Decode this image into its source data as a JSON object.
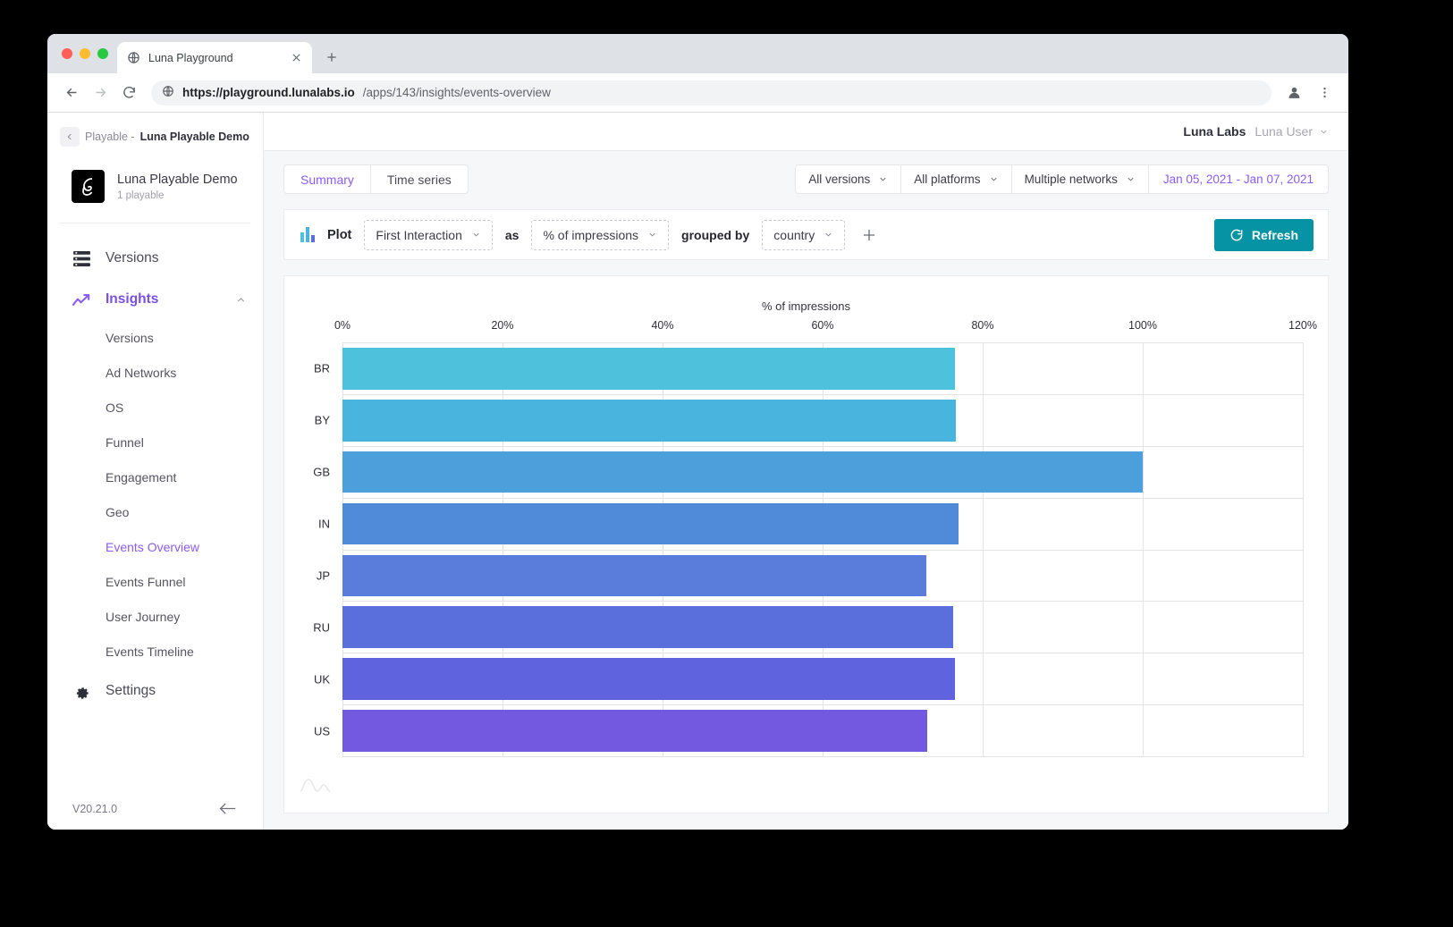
{
  "browser": {
    "tab_title": "Luna Playground",
    "tab_favicon": "globe-icon",
    "new_tab": "+",
    "close": "×",
    "url_host": "https://playground.lunalabs.io",
    "url_path": "/apps/143/insights/events-overview",
    "back_icon": "arrow-left-icon",
    "forward_icon": "arrow-right-icon",
    "reload_icon": "reload-icon",
    "profile_icon": "account-icon",
    "menu_icon": "kebab-menu-icon"
  },
  "sidebar": {
    "breadcrumb_prefix": "Playable - ",
    "breadcrumb_name": "Luna Playable Demo",
    "app_name": "Luna Playable Demo",
    "app_sub": "1 playable",
    "nav": [
      {
        "label": "Versions",
        "icon": "list-icon",
        "active": false
      },
      {
        "label": "Insights",
        "icon": "trending-up-icon",
        "active": true
      }
    ],
    "insights_children": [
      {
        "label": "Versions",
        "active": false
      },
      {
        "label": "Ad Networks",
        "active": false
      },
      {
        "label": "OS",
        "active": false
      },
      {
        "label": "Funnel",
        "active": false
      },
      {
        "label": "Engagement",
        "active": false
      },
      {
        "label": "Geo",
        "active": false
      },
      {
        "label": "Events Overview",
        "active": true
      },
      {
        "label": "Events Funnel",
        "active": false
      },
      {
        "label": "User Journey",
        "active": false
      },
      {
        "label": "Events Timeline",
        "active": false
      }
    ],
    "settings": {
      "label": "Settings",
      "icon": "gear-icon"
    },
    "version": "V20.21.0",
    "collapse_icon": "arrow-left-icon"
  },
  "topbar": {
    "org": "Luna Labs",
    "user": "Luna User",
    "caret": "chevron-down-icon"
  },
  "view_tabs": [
    {
      "label": "Summary",
      "active": true
    },
    {
      "label": "Time series",
      "active": false
    }
  ],
  "filters": [
    {
      "label": "All versions",
      "name": "versions-filter"
    },
    {
      "label": "All platforms",
      "name": "platforms-filter"
    },
    {
      "label": "Multiple networks",
      "name": "networks-filter"
    }
  ],
  "date_range": "Jan 05, 2021 - Jan 07, 2021",
  "plotbar": {
    "icon": "bar-chart-icon",
    "plot_label": "Plot",
    "metric": "First Interaction",
    "as_label": "as",
    "unit": "% of impressions",
    "grouped_by_label": "grouped by",
    "group": "country",
    "add_icon": "plus-icon",
    "refresh_label": "Refresh",
    "refresh_icon": "refresh-icon"
  },
  "colors": {
    "accent_purple": "#8b5cf6",
    "refresh_teal": "#0693a4",
    "bar_start": "#4ec1dc",
    "bar_end": "#7c6ae0"
  },
  "chart_data": {
    "type": "bar",
    "orientation": "horizontal",
    "title": "% of impressions",
    "xlabel": "",
    "ylabel": "",
    "xlim": [
      0,
      120
    ],
    "grid": true,
    "legend": "none",
    "xticks": [
      "0%",
      "20%",
      "40%",
      "60%",
      "80%",
      "100%",
      "120%"
    ],
    "xtick_values": [
      0,
      20,
      40,
      60,
      80,
      100,
      120
    ],
    "categories": [
      "BR",
      "BY",
      "GB",
      "IN",
      "JP",
      "RU",
      "UK",
      "US"
    ],
    "values": [
      76.5,
      76.6,
      100,
      77,
      73,
      76.3,
      76.5,
      73.1
    ],
    "colors": [
      "#4ec1dc",
      "#49b4dd",
      "#4d9fdb",
      "#4f8bd9",
      "#5a7ddb",
      "#5b6fdc",
      "#6063de",
      "#7259e0"
    ]
  },
  "watermark": "wave-logo-icon"
}
